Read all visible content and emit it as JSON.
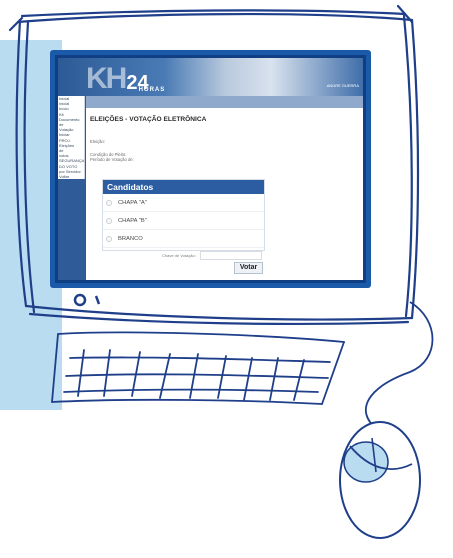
{
  "banner": {
    "logo_kh": "KH",
    "logo_number": "24",
    "logo_horas": "HORAS",
    "right_text": "ANDRE GUERRA"
  },
  "sidebar": {
    "items": [
      "",
      "Inicial",
      "Inicial",
      "Início",
      "Kit",
      "Documento",
      "de",
      "Votação",
      "Iniciar",
      "PROJ.",
      "Eleições",
      "de",
      "votos",
      "SEGURANÇA",
      "DO VOTO",
      "por Servidor",
      "",
      "Voltar"
    ]
  },
  "page": {
    "title": "ELEIÇÕES - VOTAÇÃO ELETRÔNICA",
    "eleicao_label": "Eleição:",
    "condicao_label": "Condição do Pleito:",
    "periodo_label": "Período de Votação de:"
  },
  "candidatos": {
    "header": "Candidatos",
    "options": [
      "CHAPA \"A\"",
      "CHAPA \"B\"",
      "BRANCO"
    ]
  },
  "form": {
    "chave_label": "Chave de Votação:",
    "chave_value": "",
    "votar_label": "Votar"
  },
  "colors": {
    "sketch_stroke": "#1f3f8a",
    "screen_frame": "#1b5aa8",
    "panel_header": "#2c5da3",
    "sidebar": "#2f5c98",
    "side_accent": "#b9dcf0"
  }
}
